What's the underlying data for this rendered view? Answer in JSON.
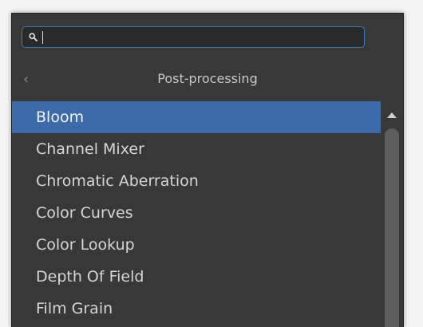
{
  "search": {
    "value": "",
    "icon": "search-icon"
  },
  "header": {
    "back_icon": "chevron-left-icon",
    "title": "Post-processing"
  },
  "list": {
    "items": [
      {
        "label": "Bloom",
        "selected": true
      },
      {
        "label": "Channel Mixer",
        "selected": false
      },
      {
        "label": "Chromatic Aberration",
        "selected": false
      },
      {
        "label": "Color Curves",
        "selected": false
      },
      {
        "label": "Color Lookup",
        "selected": false
      },
      {
        "label": "Depth Of Field",
        "selected": false
      },
      {
        "label": "Film Grain",
        "selected": false
      }
    ]
  },
  "colors": {
    "panel_bg": "#383838",
    "selection": "#3d6aa8",
    "search_border": "#3a78c4",
    "text": "#d6d6d6"
  }
}
